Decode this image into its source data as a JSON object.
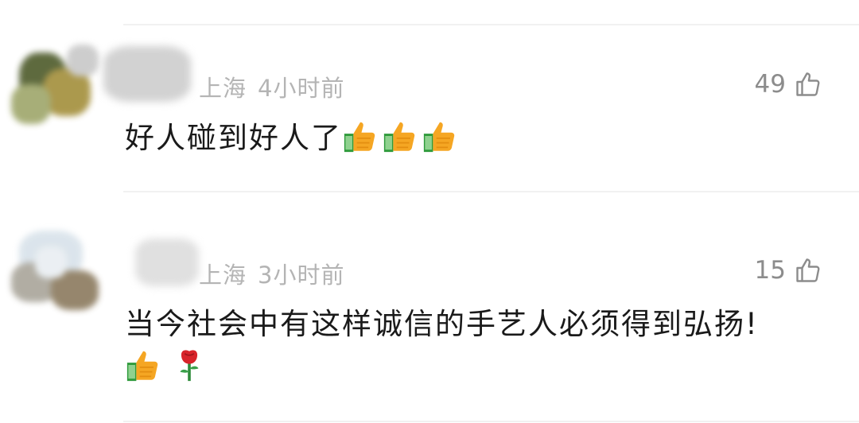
{
  "comments": [
    {
      "location": "上海",
      "time": "4小时前",
      "likes": "49",
      "text": "好人碰到好人了",
      "emojis": [
        "thumbs-up-icon",
        "thumbs-up-icon",
        "thumbs-up-icon"
      ]
    },
    {
      "location": "上海",
      "time": "3小时前",
      "likes": "15",
      "text": "当今社会中有这样诚信的手艺人必须得到弘扬!",
      "emojis": [
        "thumbs-up-icon",
        "rose-icon"
      ]
    }
  ],
  "colors": {
    "meta": "#b4b4b4",
    "text": "#1a1a1a",
    "divider": "#f1f1f1",
    "thumb": "#f5a623"
  }
}
